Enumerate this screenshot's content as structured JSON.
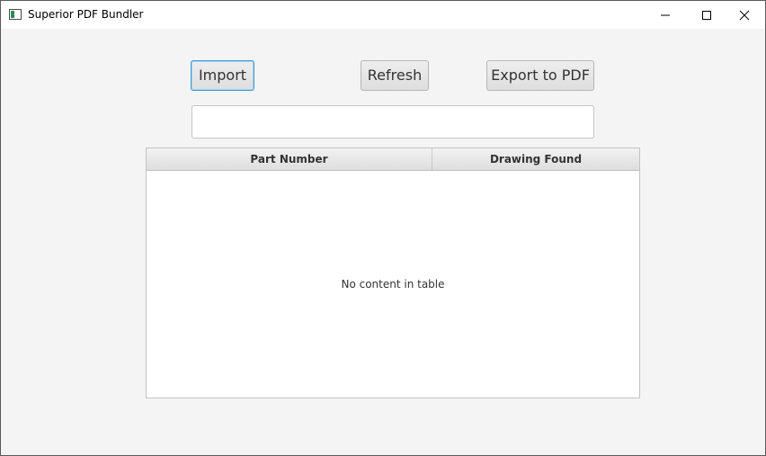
{
  "window": {
    "title": "Superior PDF Bundler",
    "controls": {
      "minimize_icon": "minimize-icon",
      "maximize_icon": "maximize-icon",
      "close_icon": "close-icon"
    }
  },
  "toolbar": {
    "import_label": "Import",
    "refresh_label": "Refresh",
    "export_label": "Export to PDF"
  },
  "path_field": {
    "value": "",
    "placeholder": ""
  },
  "table": {
    "columns": [
      "Part Number",
      "Drawing Found"
    ],
    "rows": [],
    "empty_text": "No content in table"
  },
  "colors": {
    "focus_border": "#3c9ad6",
    "background": "#f4f4f4"
  }
}
